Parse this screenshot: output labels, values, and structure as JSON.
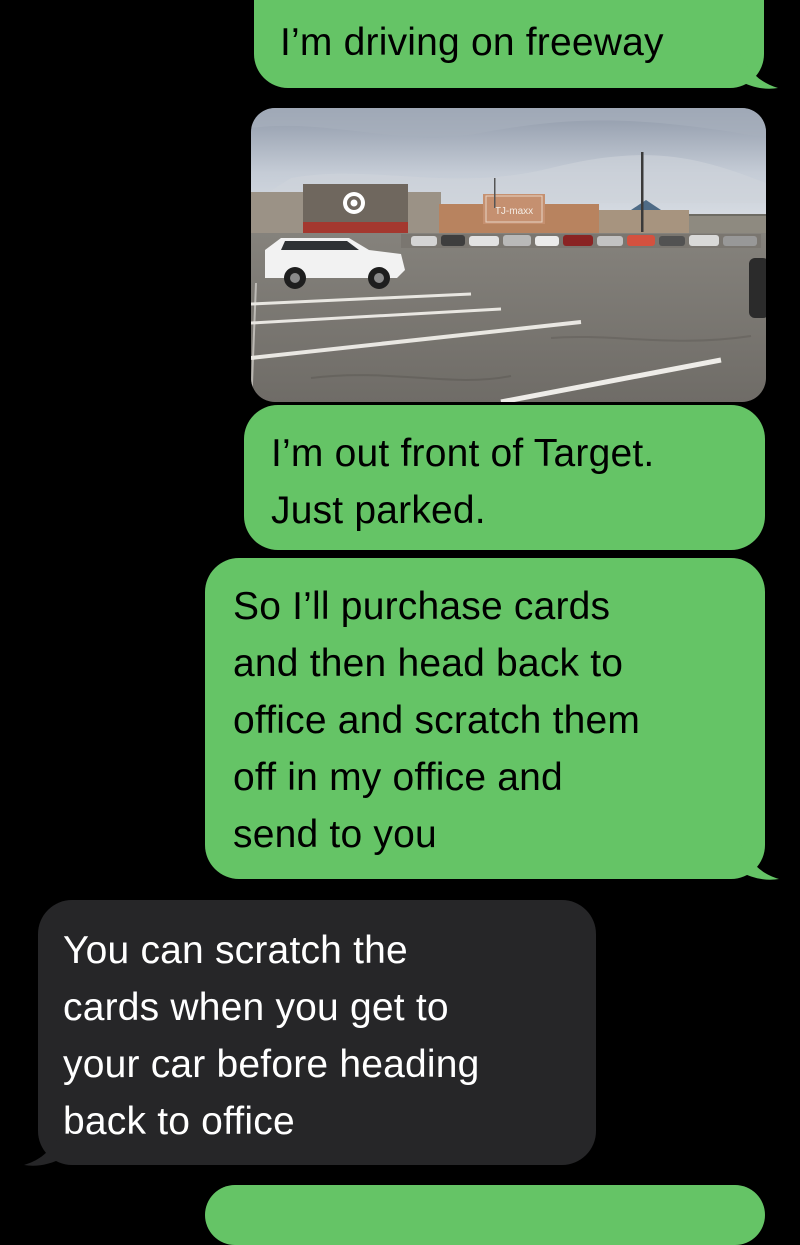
{
  "messages": [
    {
      "id": "m1",
      "direction": "sent",
      "text": "I’m driving on freeway"
    },
    {
      "id": "m2",
      "direction": "sent",
      "type": "photo",
      "photo_text": {
        "store_sign": "TJ-maxx"
      }
    },
    {
      "id": "m3",
      "direction": "sent",
      "text": "I’m out front of Target.\nJust parked."
    },
    {
      "id": "m4",
      "direction": "sent",
      "text": "So I’ll purchase cards\nand then head back to\noffice and scratch them\noff in my office and\nsend to you"
    },
    {
      "id": "m5",
      "direction": "received",
      "text": "You can scratch the\ncards when you get to\nyour car before heading\nback to office"
    },
    {
      "id": "m6",
      "direction": "sent",
      "text": ""
    }
  ],
  "colors": {
    "background": "#000000",
    "sent_bubble": "#65c466",
    "received_bubble": "#262628",
    "sent_text": "#000000",
    "received_text": "#ffffff"
  }
}
